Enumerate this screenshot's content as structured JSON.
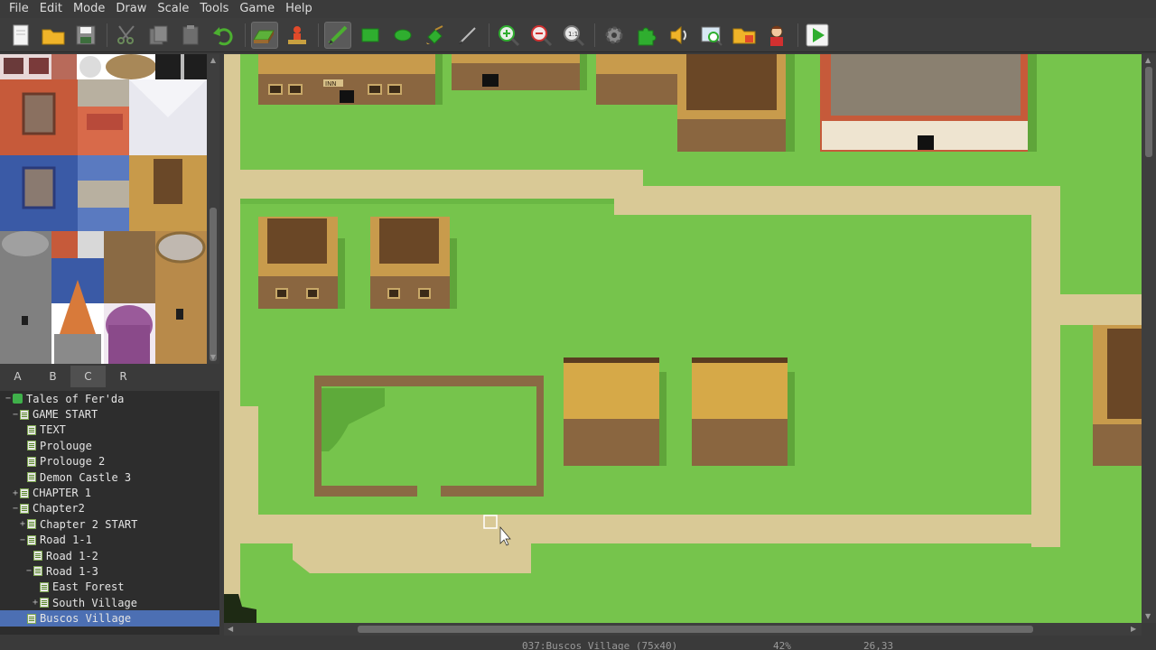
{
  "menu": [
    "File",
    "Edit",
    "Mode",
    "Draw",
    "Scale",
    "Tools",
    "Game",
    "Help"
  ],
  "toolbar": {
    "buttons": [
      {
        "name": "new-project-button",
        "icon": "new-file-icon"
      },
      {
        "name": "open-project-button",
        "icon": "folder-icon"
      },
      {
        "name": "save-project-button",
        "icon": "floppy-icon"
      },
      {
        "name": "cut-button",
        "icon": "scissors-icon"
      },
      {
        "name": "copy-button",
        "icon": "copy-icon"
      },
      {
        "name": "paste-button",
        "icon": "paste-icon"
      },
      {
        "name": "undo-button",
        "icon": "undo-icon"
      },
      {
        "name": "map-mode-button",
        "icon": "map-layer-icon"
      },
      {
        "name": "event-mode-button",
        "icon": "event-icon"
      },
      {
        "name": "pencil-button",
        "icon": "pencil-icon"
      },
      {
        "name": "rectangle-button",
        "icon": "rectangle-icon"
      },
      {
        "name": "ellipse-button",
        "icon": "ellipse-icon"
      },
      {
        "name": "fill-button",
        "icon": "fill-icon"
      },
      {
        "name": "shadow-pen-button",
        "icon": "shadow-pen-icon"
      },
      {
        "name": "zoom-in-button",
        "icon": "zoom-in-icon"
      },
      {
        "name": "zoom-out-button",
        "icon": "zoom-out-icon"
      },
      {
        "name": "zoom-actual-button",
        "icon": "zoom-actual-icon"
      },
      {
        "name": "database-button",
        "icon": "gear-icon"
      },
      {
        "name": "plugin-manager-button",
        "icon": "puzzle-icon"
      },
      {
        "name": "sound-test-button",
        "icon": "speaker-icon"
      },
      {
        "name": "event-searcher-button",
        "icon": "search-window-icon"
      },
      {
        "name": "resource-manager-button",
        "icon": "resource-folder-icon"
      },
      {
        "name": "character-generator-button",
        "icon": "character-icon"
      },
      {
        "name": "playtest-button",
        "icon": "play-icon"
      }
    ]
  },
  "tileset_tabs": [
    "A",
    "B",
    "C",
    "R"
  ],
  "tileset_active_tab": "C",
  "map_tree": [
    {
      "label": "Tales of Fer'da",
      "level": 0,
      "exp": "−",
      "kind": "project"
    },
    {
      "label": "GAME START",
      "level": 1,
      "exp": "−",
      "kind": "map"
    },
    {
      "label": "TEXT",
      "level": 2,
      "exp": "",
      "kind": "map"
    },
    {
      "label": "Prolouge",
      "level": 2,
      "exp": "",
      "kind": "map"
    },
    {
      "label": "Prolouge 2",
      "level": 2,
      "exp": "",
      "kind": "map"
    },
    {
      "label": "Demon Castle 3",
      "level": 2,
      "exp": "",
      "kind": "map"
    },
    {
      "label": "CHAPTER 1",
      "level": 1,
      "exp": "+",
      "kind": "map"
    },
    {
      "label": "Chapter2",
      "level": 1,
      "exp": "−",
      "kind": "map"
    },
    {
      "label": "Chapter 2 START",
      "level": 2,
      "exp": "+",
      "kind": "map"
    },
    {
      "label": "Road 1-1",
      "level": 2,
      "exp": "−",
      "kind": "map"
    },
    {
      "label": "Road 1-2",
      "level": 3,
      "exp": "",
      "kind": "map"
    },
    {
      "label": "Road 1-3",
      "level": 3,
      "exp": "−",
      "kind": "map"
    },
    {
      "label": "East Forest",
      "level": 4,
      "exp": "",
      "kind": "map"
    },
    {
      "label": "South Village",
      "level": 4,
      "exp": "+",
      "kind": "map"
    },
    {
      "label": "Buscos Village",
      "level": 2,
      "exp": "",
      "kind": "map",
      "selected": true
    }
  ],
  "status": {
    "map_info": "037:Buscos Village (75x40)",
    "zoom": "42%",
    "coords": "26,33"
  },
  "map": {
    "inn_sign": "INN"
  },
  "colors": {
    "grass": "#76c44c",
    "path": "#d9c996",
    "selection": "#4c6fb3"
  }
}
